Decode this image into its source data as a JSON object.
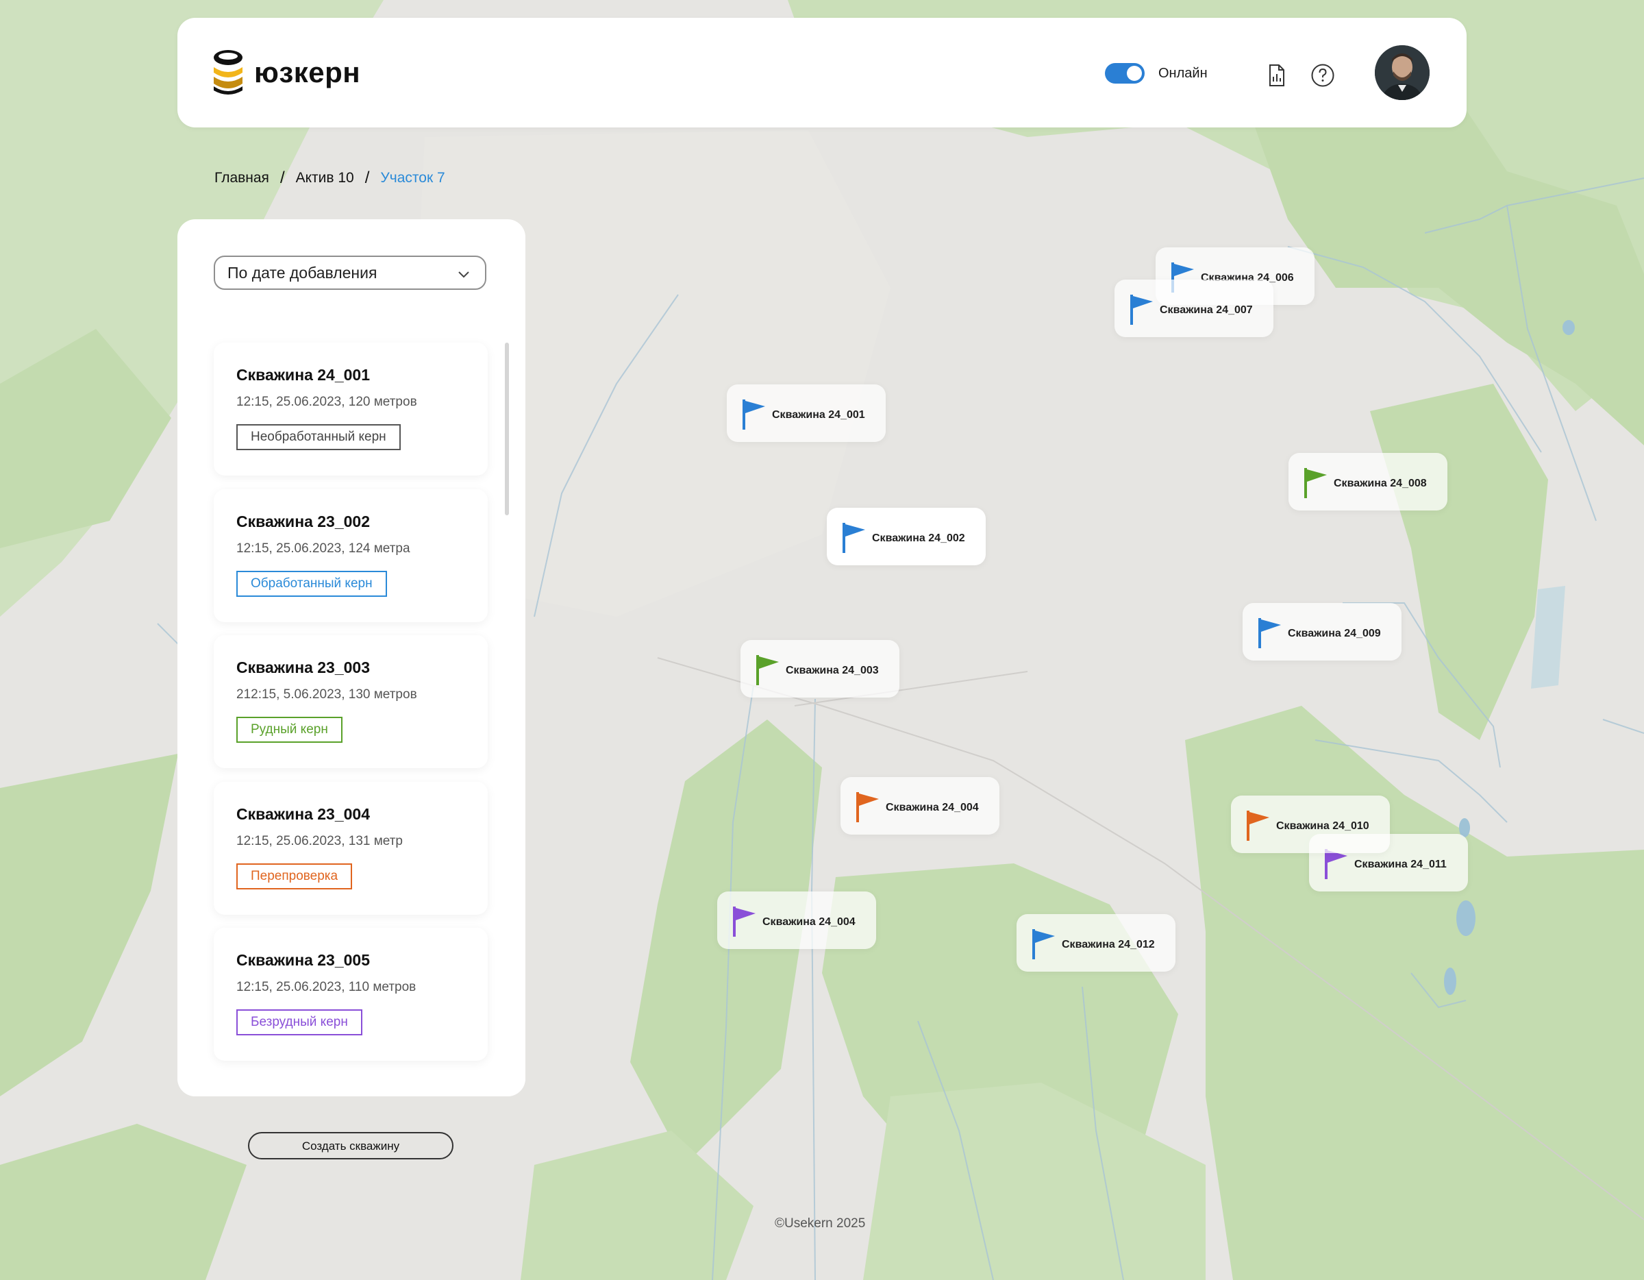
{
  "colors": {
    "accent": "#2a7fd4",
    "breadcrumb_active": "#2a8ad8",
    "badge_raw": "#555555",
    "badge_processed": "#2a8ad8",
    "badge_ore": "#5aa12a",
    "badge_recheck": "#e0651f",
    "badge_oreless": "#8a4fd8",
    "flag_blue": "#2a7fd4",
    "flag_green": "#5aa12a",
    "flag_orange": "#e0651f",
    "flag_purple": "#8a4fd8"
  },
  "header": {
    "logo_text": "юзкерн",
    "online_toggle_on": true,
    "online_label": "Онлайн",
    "report_icon": "report-file-icon",
    "help_icon": "help-circle-icon",
    "avatar_icon": "user-avatar"
  },
  "breadcrumb": {
    "items": [
      "Главная",
      "Актив 10",
      "Участок 7"
    ],
    "separator": "/"
  },
  "sidebar": {
    "sort_select": {
      "value": "По дате добавления",
      "icon": "chevron-down-icon"
    },
    "wells": [
      {
        "title": "Скважина 24_001",
        "meta": "12:15, 25.06.2023, 120 метров",
        "badge": "Необработанный керн",
        "badge_color": "#555555"
      },
      {
        "title": "Скважина 23_002",
        "meta": "12:15, 25.06.2023, 124 метра",
        "badge": "Обработанный керн",
        "badge_color": "#2a8ad8"
      },
      {
        "title": "Скважина 23_003",
        "meta": "212:15, 5.06.2023, 130 метров",
        "badge": "Рудный керн",
        "badge_color": "#5aa12a"
      },
      {
        "title": "Скважина 23_004",
        "meta": "12:15, 25.06.2023, 131 метр",
        "badge": "Перепроверка",
        "badge_color": "#e0651f"
      },
      {
        "title": "Скважина 23_005",
        "meta": "12:15, 25.06.2023, 110 метров",
        "badge": "Безрудный керн",
        "badge_color": "#8a4fd8"
      }
    ],
    "create_button": "Создать скважину"
  },
  "map": {
    "markers": [
      {
        "label": "Скважина 24_006",
        "color": "#2a7fd4"
      },
      {
        "label": "Скважина 24_007",
        "color": "#2a7fd4"
      },
      {
        "label": "Скважина 24_001",
        "color": "#2a7fd4"
      },
      {
        "label": "Скважина 24_008",
        "color": "#5aa12a"
      },
      {
        "label": "Скважина 24_002",
        "color": "#2a7fd4"
      },
      {
        "label": "Скважина 24_009",
        "color": "#2a7fd4"
      },
      {
        "label": "Скважина 24_003",
        "color": "#5aa12a"
      },
      {
        "label": "Скважина 24_004",
        "color": "#e0651f"
      },
      {
        "label": "Скважина 24_011",
        "color": "#8a4fd8"
      },
      {
        "label": "Скважина 24_010",
        "color": "#e0651f"
      },
      {
        "label": "Скважина 24_004",
        "color": "#8a4fd8"
      },
      {
        "label": "Скважина 24_012",
        "color": "#2a7fd4"
      }
    ]
  },
  "footer": {
    "copyright": "©Usekern 2025"
  }
}
